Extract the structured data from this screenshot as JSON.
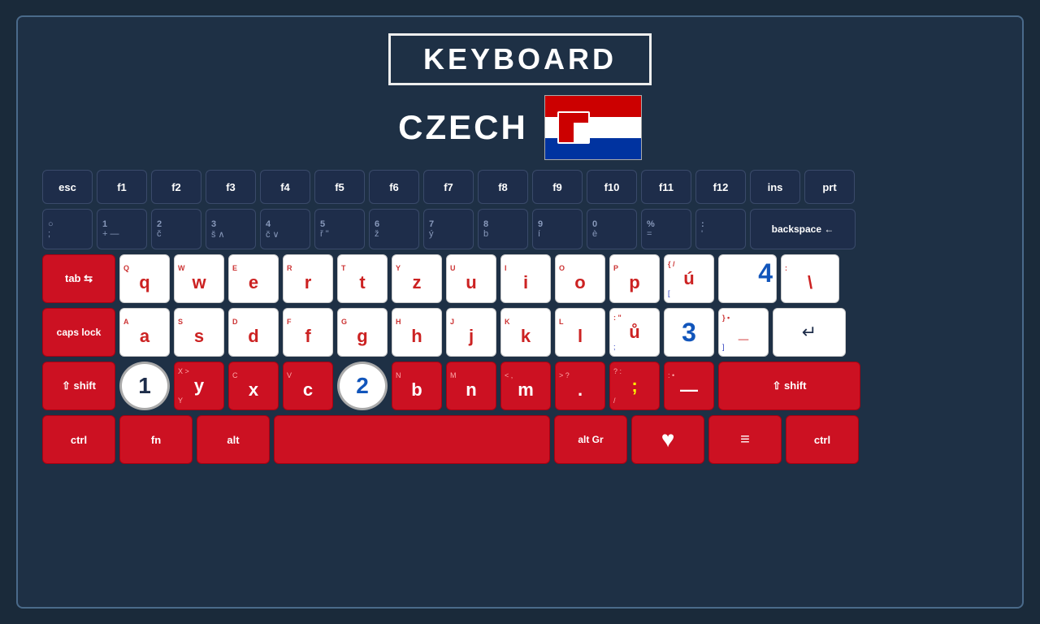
{
  "header": {
    "title": "KEYBOARD",
    "language": "CZECH"
  },
  "fn_row": [
    {
      "label": "esc"
    },
    {
      "label": "f1"
    },
    {
      "label": "f2"
    },
    {
      "label": "f3"
    },
    {
      "label": "f4"
    },
    {
      "label": "f5"
    },
    {
      "label": "f6"
    },
    {
      "label": "f7"
    },
    {
      "label": "f8"
    },
    {
      "label": "f9"
    },
    {
      "label": "f10"
    },
    {
      "label": "f11"
    },
    {
      "label": "f12"
    },
    {
      "label": "ins"
    },
    {
      "label": "prt"
    }
  ],
  "num_row": [
    {
      "top": "○",
      "bot": ";"
    },
    {
      "top": "1",
      "bot": "+  —"
    },
    {
      "top": "2",
      "bot": "č"
    },
    {
      "top": "3",
      "bot": "š  ∧"
    },
    {
      "top": "4",
      "bot": "č  ∨"
    },
    {
      "top": "5",
      "bot": "ř  \""
    },
    {
      "top": "6",
      "bot": "ž"
    },
    {
      "top": "7",
      "bot": "ý"
    },
    {
      "top": "8",
      "bot": "b"
    },
    {
      "top": "9",
      "bot": "í"
    },
    {
      "top": "0",
      "bot": "è"
    },
    {
      "top": "%",
      "bot": "="
    },
    {
      "top": ":",
      "bot": "'"
    },
    {
      "label": "backspace ←"
    }
  ],
  "qwerty_row": [
    {
      "label": "tab",
      "symbol": "⇆"
    },
    {
      "top": "Q",
      "main": "q",
      "sub": ""
    },
    {
      "top": "W",
      "main": "w",
      "sub": ""
    },
    {
      "top": "E",
      "main": "e",
      "sub": ""
    },
    {
      "top": "R",
      "main": "r",
      "sub": ""
    },
    {
      "top": "T",
      "main": "t",
      "sub": ""
    },
    {
      "top": "Y",
      "main": "z",
      "sub": ""
    },
    {
      "top": "U",
      "main": "u",
      "sub": ""
    },
    {
      "top": "I",
      "main": "i",
      "sub": ""
    },
    {
      "top": "O",
      "main": "o",
      "sub": ""
    },
    {
      "top": "P",
      "main": "p",
      "sub": ""
    },
    {
      "top": "{ /",
      "main": "ú",
      "sub": "["
    },
    {
      "badge": "4"
    },
    {
      "top": ":",
      "main": "\\",
      "sub": ""
    }
  ],
  "asdf_row": [
    {
      "label": "caps lock"
    },
    {
      "top": "A",
      "main": "a",
      "sub": ""
    },
    {
      "top": "S",
      "main": "s",
      "sub": ""
    },
    {
      "top": "D",
      "main": "d",
      "sub": ""
    },
    {
      "top": "F",
      "main": "f",
      "sub": ""
    },
    {
      "top": "G",
      "main": "g",
      "sub": ""
    },
    {
      "top": "H",
      "main": "h",
      "sub": ""
    },
    {
      "top": "J",
      "main": "j",
      "sub": ""
    },
    {
      "top": "K",
      "main": "k",
      "sub": ""
    },
    {
      "top": "L",
      "main": "l",
      "sub": ""
    },
    {
      "top": ": \"",
      "main": "ů",
      "sub": ";"
    },
    {
      "badge": "3"
    },
    {
      "top": "} •",
      "main": "_",
      "sub": "]"
    },
    {
      "label": "⏎",
      "isEnter": true
    }
  ],
  "zxcv_row": [
    {
      "label": "⇧ shift",
      "isShift": true
    },
    {
      "circle": "1"
    },
    {
      "top": "X >",
      "main": "y",
      "sub": "Y"
    },
    {
      "top": "C",
      "main": "x",
      "sub": ""
    },
    {
      "top": "V",
      "main": "c",
      "sub": ""
    },
    {
      "circle": "2"
    },
    {
      "top": "N",
      "main": "b",
      "sub": ""
    },
    {
      "top": "M",
      "main": "n",
      "sub": ""
    },
    {
      "top": "< ,",
      "main": "m",
      "sub": ""
    },
    {
      "top": "> ?",
      "main": ".",
      "sub": ""
    },
    {
      "top": "? :",
      "main": ";",
      "sub": "/"
    },
    {
      "top": ": •",
      "main": "-",
      "sub": ""
    },
    {
      "label": "⇧ shift",
      "isShiftR": true
    }
  ],
  "bottom_row": {
    "ctrl": "ctrl",
    "fn": "fn",
    "alt": "alt",
    "altgr": "alt Gr",
    "ctrl2": "ctrl"
  }
}
